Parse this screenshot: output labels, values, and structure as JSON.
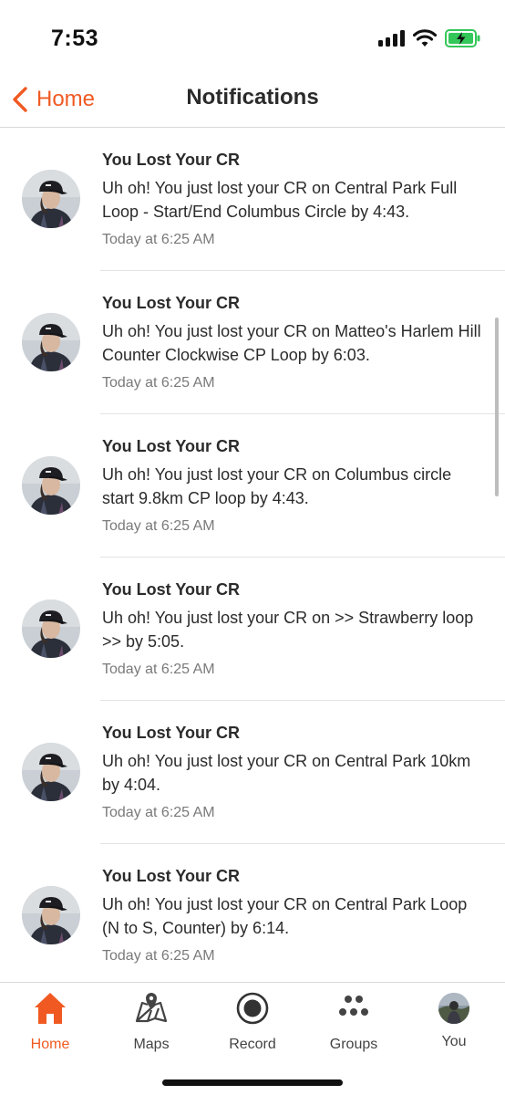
{
  "status_bar": {
    "time": "7:53"
  },
  "header": {
    "back_label": "Home",
    "title": "Notifications"
  },
  "notifications": [
    {
      "title": "You Lost Your CR",
      "body": "Uh oh! You just lost your CR on Central Park Full Loop - Start/End Columbus Circle by 4:43.",
      "time": "Today at 6:25 AM"
    },
    {
      "title": "You Lost Your CR",
      "body": "Uh oh! You just lost your CR on Matteo's Harlem Hill Counter Clockwise CP Loop by 6:03.",
      "time": "Today at 6:25 AM"
    },
    {
      "title": "You Lost Your CR",
      "body": "Uh oh! You just lost your CR on Columbus circle start 9.8km CP loop by 4:43.",
      "time": "Today at 6:25 AM"
    },
    {
      "title": "You Lost Your CR",
      "body": "Uh oh! You just lost your CR on >> Strawberry loop >> by 5:05.",
      "time": "Today at 6:25 AM"
    },
    {
      "title": "You Lost Your CR",
      "body": "Uh oh! You just lost your CR on Central Park 10km  by 4:04.",
      "time": "Today at 6:25 AM"
    },
    {
      "title": "You Lost Your CR",
      "body": "Uh oh! You just lost your CR on Central Park Loop (N to S, Counter) by 6:14.",
      "time": "Today at 6:25 AM"
    }
  ],
  "tab_bar": {
    "home": "Home",
    "maps": "Maps",
    "record": "Record",
    "groups": "Groups",
    "you": "You"
  },
  "colors": {
    "accent": "#f05a22",
    "battery_green": "#34c759"
  },
  "icons": [
    "signal-icon",
    "wifi-icon",
    "battery-icon",
    "chevron-left-icon",
    "home-icon",
    "map-icon",
    "record-icon",
    "groups-icon"
  ]
}
